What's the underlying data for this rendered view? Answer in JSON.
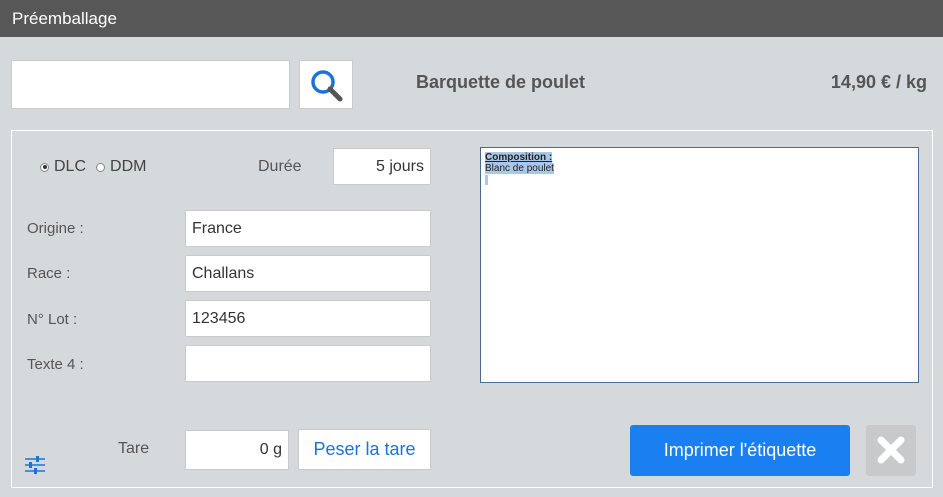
{
  "window": {
    "title": "Préemballage"
  },
  "search": {
    "value": "",
    "placeholder": ""
  },
  "product": {
    "name": "Barquette de poulet",
    "price": "14,90 € / kg"
  },
  "date_type": {
    "options": [
      "DLC",
      "DDM"
    ],
    "selected": "DLC"
  },
  "duration": {
    "label": "Durée",
    "value": "5 jours"
  },
  "fields": {
    "origine": {
      "label": "Origine :",
      "value": "France"
    },
    "race": {
      "label": "Race :",
      "value": "Challans"
    },
    "lot": {
      "label": "N° Lot :",
      "value": "123456"
    },
    "texte4": {
      "label": "Texte 4 :",
      "value": ""
    }
  },
  "composition": {
    "title": "Composition :",
    "text": "Blanc de poulet"
  },
  "tare": {
    "label": "Tare",
    "value": "0 g",
    "button": "Peser la tare"
  },
  "actions": {
    "print": "Imprimer l'étiquette"
  },
  "icons": {
    "search": "search-icon",
    "close": "close-icon",
    "settings": "sliders-icon"
  },
  "colors": {
    "accent": "#1a7ff0",
    "titlebar": "#575757",
    "link": "#1a73d9"
  }
}
